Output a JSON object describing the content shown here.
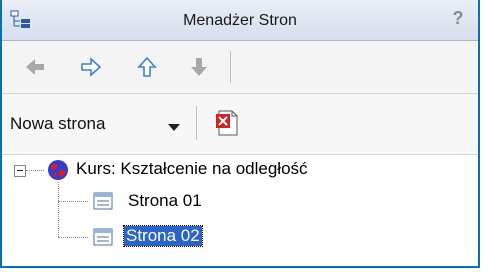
{
  "window": {
    "title": "Menadżer Stron"
  },
  "toolbar": {
    "new_page_label": "Nowa strona"
  },
  "tree": {
    "course_label": "Kurs: Kształcenie na odległość",
    "pages": [
      {
        "label": "Strona 01",
        "selected": false
      },
      {
        "label": "Strona 02",
        "selected": true
      }
    ]
  },
  "icons": [
    "app-tree-icon",
    "help-icon",
    "back-icon",
    "forward-icon",
    "up-icon",
    "down-icon",
    "dropdown-arrow-icon",
    "delete-page-icon",
    "expander-icon",
    "globe-icon",
    "page-icon"
  ],
  "colors": {
    "frame_border": "#0a6fb0",
    "selection": "#2a64c8",
    "nav_arrow_active": "#3d7fd8",
    "nav_arrow_disabled": "#a8a8a8",
    "delete_red": "#d42020"
  }
}
